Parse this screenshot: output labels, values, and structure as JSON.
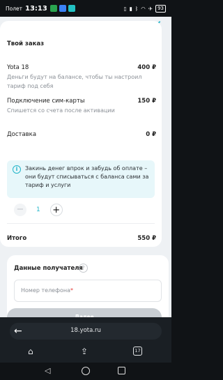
{
  "status_bar": {
    "carrier": "Полет",
    "time": "13:13",
    "battery": "93"
  },
  "order": {
    "title": "Твой заказ",
    "items": [
      {
        "name": "Yota 18",
        "price": "400 ₽",
        "desc": "Деньги будут на балансе, чтобы ты настроил тариф под себя"
      },
      {
        "name": "Подключение сим-карты",
        "price": "150 ₽",
        "desc": "Спишется со счета после активации"
      },
      {
        "name": "Доставка",
        "price": "0 ₽",
        "desc": ""
      }
    ],
    "info_text": "Закинь денег впрок и забудь об оплате – они будут списываться с баланса сами за тариф и услуги",
    "quantity": "1",
    "total_label": "Итого",
    "total_value": "550 ₽"
  },
  "recipient": {
    "title": "Данные получателя",
    "phone_placeholder": "Номер телефона",
    "required_mark": "*"
  },
  "submit_label": "Далее",
  "browser": {
    "url": "18.yota.ru",
    "tabs_count": "17"
  },
  "colors": {
    "accent": "#23b5c9",
    "disabled_button": "#c9ced3"
  }
}
